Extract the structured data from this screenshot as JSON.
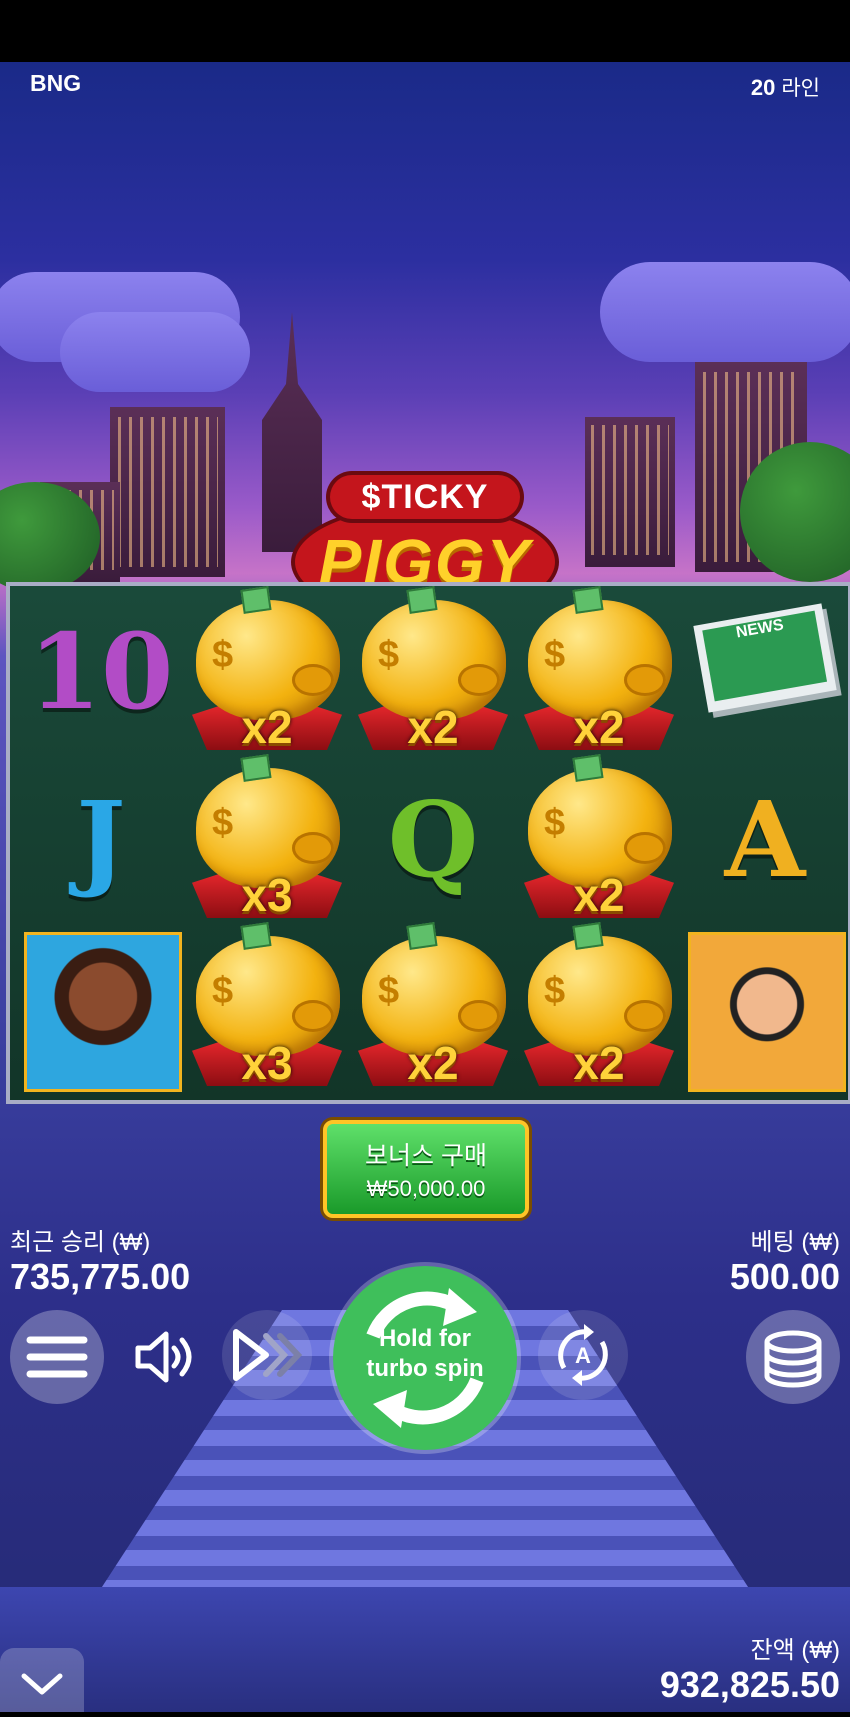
{
  "header": {
    "provider": "BNG",
    "lines_count": "20",
    "lines_label": "라인"
  },
  "logo": {
    "top": "$TICKY",
    "main": "PIGGY"
  },
  "reels": [
    [
      {
        "type": "letter",
        "value": "10",
        "color": "#b24cc6"
      },
      {
        "type": "letter",
        "value": "J",
        "color": "#2aa7e6"
      },
      {
        "type": "portrait",
        "name": "woman-with-crowbar"
      }
    ],
    [
      {
        "type": "pig",
        "mult": "x2"
      },
      {
        "type": "pig",
        "mult": "x3"
      },
      {
        "type": "pig",
        "mult": "x3"
      }
    ],
    [
      {
        "type": "pig",
        "mult": "x2"
      },
      {
        "type": "letter",
        "value": "Q",
        "color": "#6fbf2a"
      },
      {
        "type": "pig",
        "mult": "x2"
      }
    ],
    [
      {
        "type": "pig",
        "mult": "x2"
      },
      {
        "type": "pig",
        "mult": "x2"
      },
      {
        "type": "pig",
        "mult": "x2"
      }
    ],
    [
      {
        "type": "news",
        "value": "NEWS"
      },
      {
        "type": "letter",
        "value": "A",
        "color": "#f0b020"
      },
      {
        "type": "portrait",
        "name": "mustached-man-top-hat"
      }
    ]
  ],
  "bonus": {
    "label": "보너스 구매",
    "price": "₩50,000.00"
  },
  "stats": {
    "last_win_label": "최근 승리 (₩)",
    "last_win_value": "735,775.00",
    "bet_label": "베팅 (₩)",
    "bet_value": "500.00",
    "balance_label": "잔액 (₩)",
    "balance_value": "932,825.50"
  },
  "controls": {
    "spin_text_1": "Hold for",
    "spin_text_2": "turbo spin",
    "icons": [
      "menu-icon",
      "sound-icon",
      "turbo-icon",
      "spin-icon",
      "autoplay-icon",
      "coins-icon",
      "chevron-down-icon"
    ]
  },
  "colors": {
    "spin_green": "#3fbf5b",
    "bonus_border": "#ffc526",
    "multiplier": "#ffd23a"
  }
}
